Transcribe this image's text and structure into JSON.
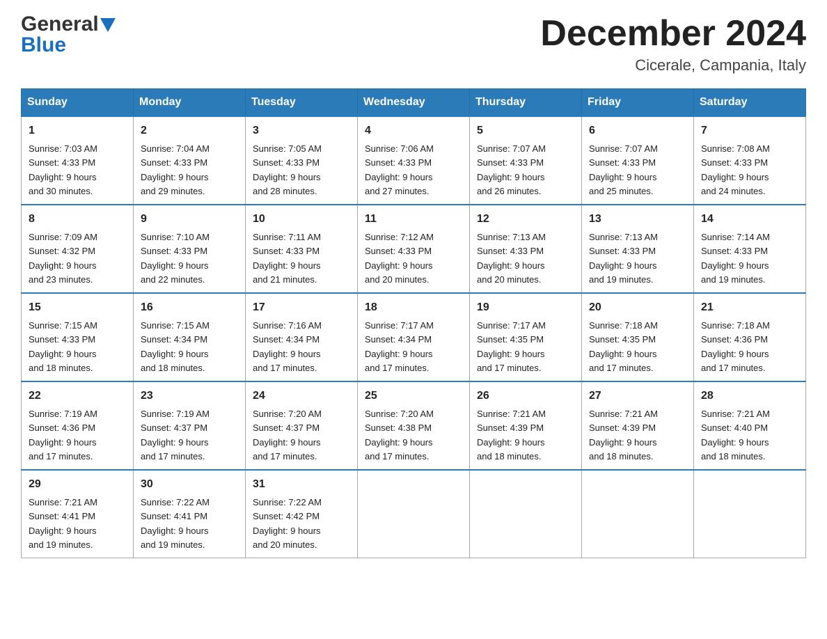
{
  "logo": {
    "general": "General",
    "blue": "Blue"
  },
  "title": "December 2024",
  "location": "Cicerale, Campania, Italy",
  "days_of_week": [
    "Sunday",
    "Monday",
    "Tuesday",
    "Wednesday",
    "Thursday",
    "Friday",
    "Saturday"
  ],
  "weeks": [
    [
      {
        "num": "1",
        "sunrise": "7:03 AM",
        "sunset": "4:33 PM",
        "daylight": "9 hours and 30 minutes."
      },
      {
        "num": "2",
        "sunrise": "7:04 AM",
        "sunset": "4:33 PM",
        "daylight": "9 hours and 29 minutes."
      },
      {
        "num": "3",
        "sunrise": "7:05 AM",
        "sunset": "4:33 PM",
        "daylight": "9 hours and 28 minutes."
      },
      {
        "num": "4",
        "sunrise": "7:06 AM",
        "sunset": "4:33 PM",
        "daylight": "9 hours and 27 minutes."
      },
      {
        "num": "5",
        "sunrise": "7:07 AM",
        "sunset": "4:33 PM",
        "daylight": "9 hours and 26 minutes."
      },
      {
        "num": "6",
        "sunrise": "7:07 AM",
        "sunset": "4:33 PM",
        "daylight": "9 hours and 25 minutes."
      },
      {
        "num": "7",
        "sunrise": "7:08 AM",
        "sunset": "4:33 PM",
        "daylight": "9 hours and 24 minutes."
      }
    ],
    [
      {
        "num": "8",
        "sunrise": "7:09 AM",
        "sunset": "4:32 PM",
        "daylight": "9 hours and 23 minutes."
      },
      {
        "num": "9",
        "sunrise": "7:10 AM",
        "sunset": "4:33 PM",
        "daylight": "9 hours and 22 minutes."
      },
      {
        "num": "10",
        "sunrise": "7:11 AM",
        "sunset": "4:33 PM",
        "daylight": "9 hours and 21 minutes."
      },
      {
        "num": "11",
        "sunrise": "7:12 AM",
        "sunset": "4:33 PM",
        "daylight": "9 hours and 20 minutes."
      },
      {
        "num": "12",
        "sunrise": "7:13 AM",
        "sunset": "4:33 PM",
        "daylight": "9 hours and 20 minutes."
      },
      {
        "num": "13",
        "sunrise": "7:13 AM",
        "sunset": "4:33 PM",
        "daylight": "9 hours and 19 minutes."
      },
      {
        "num": "14",
        "sunrise": "7:14 AM",
        "sunset": "4:33 PM",
        "daylight": "9 hours and 19 minutes."
      }
    ],
    [
      {
        "num": "15",
        "sunrise": "7:15 AM",
        "sunset": "4:33 PM",
        "daylight": "9 hours and 18 minutes."
      },
      {
        "num": "16",
        "sunrise": "7:15 AM",
        "sunset": "4:34 PM",
        "daylight": "9 hours and 18 minutes."
      },
      {
        "num": "17",
        "sunrise": "7:16 AM",
        "sunset": "4:34 PM",
        "daylight": "9 hours and 17 minutes."
      },
      {
        "num": "18",
        "sunrise": "7:17 AM",
        "sunset": "4:34 PM",
        "daylight": "9 hours and 17 minutes."
      },
      {
        "num": "19",
        "sunrise": "7:17 AM",
        "sunset": "4:35 PM",
        "daylight": "9 hours and 17 minutes."
      },
      {
        "num": "20",
        "sunrise": "7:18 AM",
        "sunset": "4:35 PM",
        "daylight": "9 hours and 17 minutes."
      },
      {
        "num": "21",
        "sunrise": "7:18 AM",
        "sunset": "4:36 PM",
        "daylight": "9 hours and 17 minutes."
      }
    ],
    [
      {
        "num": "22",
        "sunrise": "7:19 AM",
        "sunset": "4:36 PM",
        "daylight": "9 hours and 17 minutes."
      },
      {
        "num": "23",
        "sunrise": "7:19 AM",
        "sunset": "4:37 PM",
        "daylight": "9 hours and 17 minutes."
      },
      {
        "num": "24",
        "sunrise": "7:20 AM",
        "sunset": "4:37 PM",
        "daylight": "9 hours and 17 minutes."
      },
      {
        "num": "25",
        "sunrise": "7:20 AM",
        "sunset": "4:38 PM",
        "daylight": "9 hours and 17 minutes."
      },
      {
        "num": "26",
        "sunrise": "7:21 AM",
        "sunset": "4:39 PM",
        "daylight": "9 hours and 18 minutes."
      },
      {
        "num": "27",
        "sunrise": "7:21 AM",
        "sunset": "4:39 PM",
        "daylight": "9 hours and 18 minutes."
      },
      {
        "num": "28",
        "sunrise": "7:21 AM",
        "sunset": "4:40 PM",
        "daylight": "9 hours and 18 minutes."
      }
    ],
    [
      {
        "num": "29",
        "sunrise": "7:21 AM",
        "sunset": "4:41 PM",
        "daylight": "9 hours and 19 minutes."
      },
      {
        "num": "30",
        "sunrise": "7:22 AM",
        "sunset": "4:41 PM",
        "daylight": "9 hours and 19 minutes."
      },
      {
        "num": "31",
        "sunrise": "7:22 AM",
        "sunset": "4:42 PM",
        "daylight": "9 hours and 20 minutes."
      },
      null,
      null,
      null,
      null
    ]
  ],
  "labels": {
    "sunrise": "Sunrise:",
    "sunset": "Sunset:",
    "daylight": "Daylight:"
  }
}
